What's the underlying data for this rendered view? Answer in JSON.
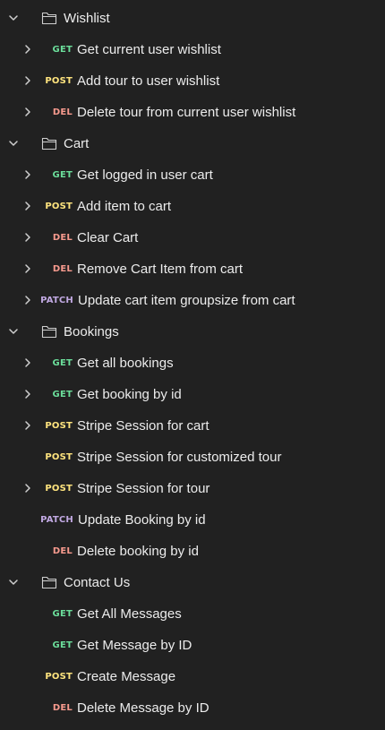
{
  "colors": {
    "background": "#212121",
    "text": "#ececec",
    "chevron": "#d0d0d0",
    "get": "#6bdd9a",
    "post": "#ffe47e",
    "del": "#f79a8e",
    "patch": "#c0a8e1"
  },
  "icons": {
    "expanded": "chevron-down-icon",
    "collapsed": "chevron-right-icon",
    "folder": "folder-icon"
  },
  "rows": [
    {
      "type": "folder",
      "label": "Wishlist",
      "expanded": true
    },
    {
      "type": "request",
      "method": "GET",
      "label": "Get current user wishlist",
      "chevron": true
    },
    {
      "type": "request",
      "method": "POST",
      "label": "Add tour to user wishlist",
      "chevron": true
    },
    {
      "type": "request",
      "method": "DEL",
      "label": "Delete tour from current user wishlist",
      "chevron": true
    },
    {
      "type": "folder",
      "label": "Cart",
      "expanded": true
    },
    {
      "type": "request",
      "method": "GET",
      "label": "Get logged in user cart",
      "chevron": true
    },
    {
      "type": "request",
      "method": "POST",
      "label": "Add item to cart",
      "chevron": true
    },
    {
      "type": "request",
      "method": "DEL",
      "label": "Clear Cart",
      "chevron": true
    },
    {
      "type": "request",
      "method": "DEL",
      "label": "Remove Cart Item from cart",
      "chevron": true
    },
    {
      "type": "request",
      "method": "PATCH",
      "label": "Update cart item groupsize from cart",
      "chevron": true
    },
    {
      "type": "folder",
      "label": "Bookings",
      "expanded": true
    },
    {
      "type": "request",
      "method": "GET",
      "label": "Get all bookings",
      "chevron": true
    },
    {
      "type": "request",
      "method": "GET",
      "label": "Get booking by id",
      "chevron": true
    },
    {
      "type": "request",
      "method": "POST",
      "label": "Stripe Session for cart",
      "chevron": true
    },
    {
      "type": "request",
      "method": "POST",
      "label": "Stripe Session for customized tour",
      "chevron": false
    },
    {
      "type": "request",
      "method": "POST",
      "label": "Stripe Session for tour",
      "chevron": true
    },
    {
      "type": "request",
      "method": "PATCH",
      "label": "Update Booking by id",
      "chevron": false
    },
    {
      "type": "request",
      "method": "DEL",
      "label": "Delete booking by id",
      "chevron": false
    },
    {
      "type": "folder",
      "label": "Contact Us",
      "expanded": true
    },
    {
      "type": "request",
      "method": "GET",
      "label": "Get All Messages",
      "chevron": false
    },
    {
      "type": "request",
      "method": "GET",
      "label": "Get Message by ID",
      "chevron": false
    },
    {
      "type": "request",
      "method": "POST",
      "label": "Create Message",
      "chevron": false
    },
    {
      "type": "request",
      "method": "DEL",
      "label": "Delete Message by ID",
      "chevron": false
    }
  ]
}
